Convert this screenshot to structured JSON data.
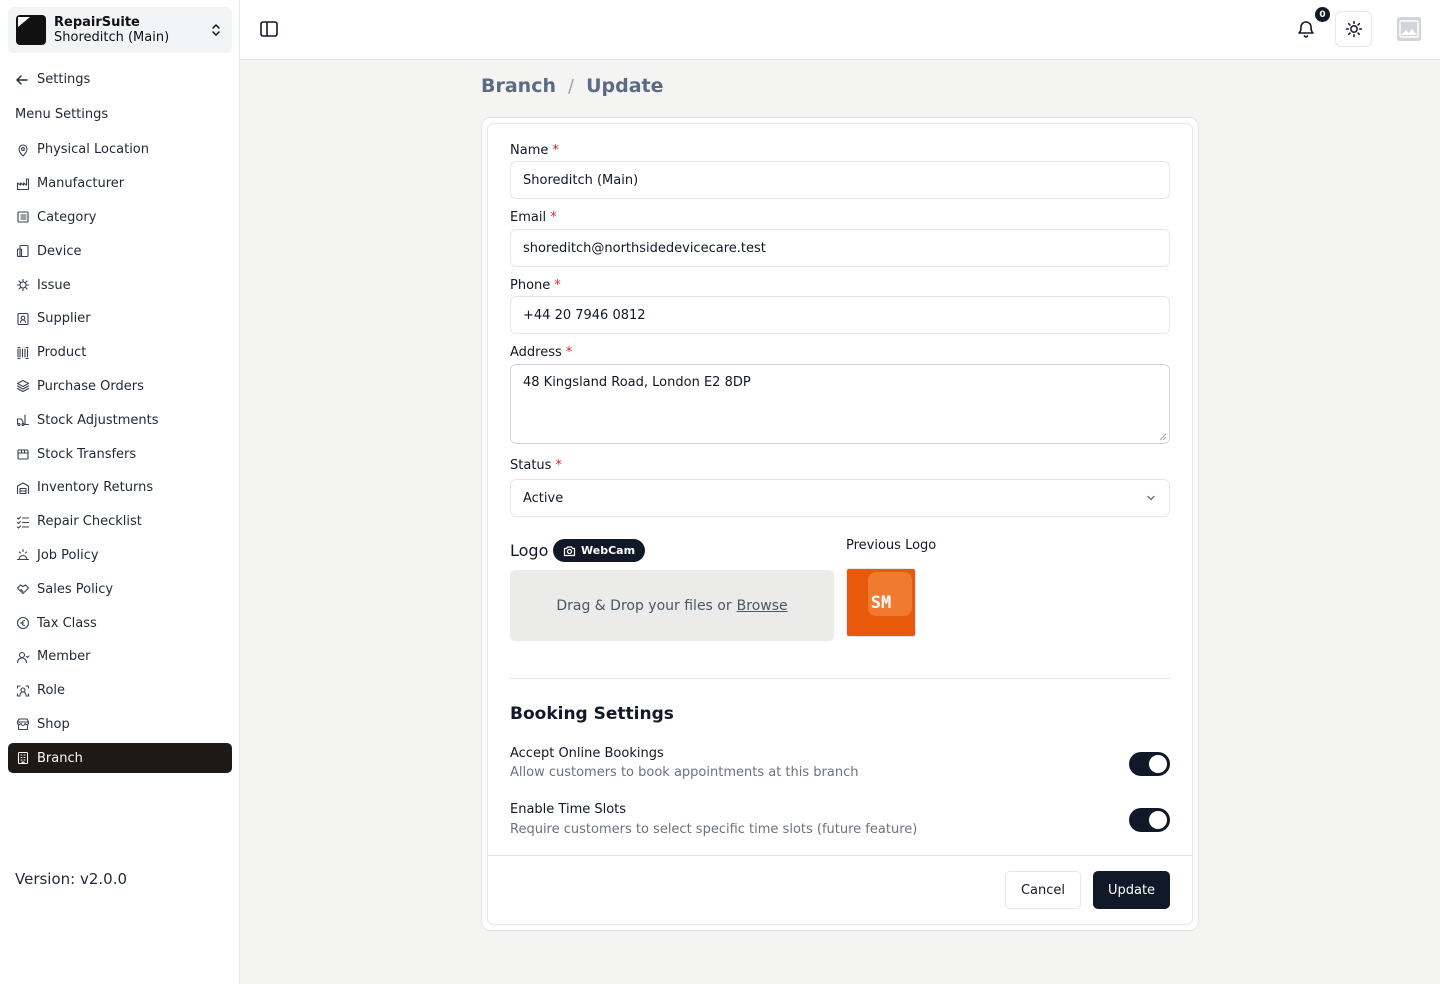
{
  "brand": {
    "name": "RepairSuite",
    "branch": "Shoreditch (Main)"
  },
  "sidebar": {
    "back_label": "Settings",
    "heading": "Menu Settings",
    "items": [
      {
        "label": "Physical Location",
        "icon": "map-pin-icon"
      },
      {
        "label": "Manufacturer",
        "icon": "factory-icon"
      },
      {
        "label": "Category",
        "icon": "list-icon"
      },
      {
        "label": "Device",
        "icon": "device-icon"
      },
      {
        "label": "Issue",
        "icon": "bug-icon"
      },
      {
        "label": "Supplier",
        "icon": "contact-icon"
      },
      {
        "label": "Product",
        "icon": "barcode-icon"
      },
      {
        "label": "Purchase Orders",
        "icon": "layers-icon"
      },
      {
        "label": "Stock Adjustments",
        "icon": "forklift-icon"
      },
      {
        "label": "Stock Transfers",
        "icon": "package-icon"
      },
      {
        "label": "Inventory Returns",
        "icon": "warehouse-icon"
      },
      {
        "label": "Repair Checklist",
        "icon": "checklist-icon"
      },
      {
        "label": "Job Policy",
        "icon": "policy-icon"
      },
      {
        "label": "Sales Policy",
        "icon": "handshake-icon"
      },
      {
        "label": "Tax Class",
        "icon": "coin-icon"
      },
      {
        "label": "Member",
        "icon": "user-icon"
      },
      {
        "label": "Role",
        "icon": "role-icon"
      },
      {
        "label": "Shop",
        "icon": "store-icon"
      },
      {
        "label": "Branch",
        "icon": "building-icon",
        "active": true
      }
    ],
    "version": "Version: v2.0.0"
  },
  "topbar": {
    "notification_count": "0"
  },
  "breadcrumb": {
    "parent": "Branch",
    "separator": "/",
    "current": "Update"
  },
  "form": {
    "name": {
      "label": "Name",
      "value": "Shoreditch (Main)"
    },
    "email": {
      "label": "Email",
      "value": "shoreditch@northsidedevicecare.test"
    },
    "phone": {
      "label": "Phone",
      "value": "+44 20 7946 0812"
    },
    "address": {
      "label": "Address",
      "value": "48 Kingsland Road, London E2 8DP"
    },
    "status": {
      "label": "Status",
      "value": "Active"
    },
    "required_mark": "*",
    "logo": {
      "label": "Logo",
      "webcam_label": "WebCam",
      "dropzone_text": "Drag & Drop your files or",
      "browse_label": "Browse",
      "previous_label": "Previous Logo",
      "previous_text": "SM"
    }
  },
  "booking": {
    "title": "Booking Settings",
    "settings": [
      {
        "title": "Accept Online Bookings",
        "description": "Allow customers to book appointments at this branch",
        "enabled": true
      },
      {
        "title": "Enable Time Slots",
        "description": "Require customers to select specific time slots (future feature)",
        "enabled": true
      }
    ]
  },
  "actions": {
    "cancel": "Cancel",
    "update": "Update"
  }
}
